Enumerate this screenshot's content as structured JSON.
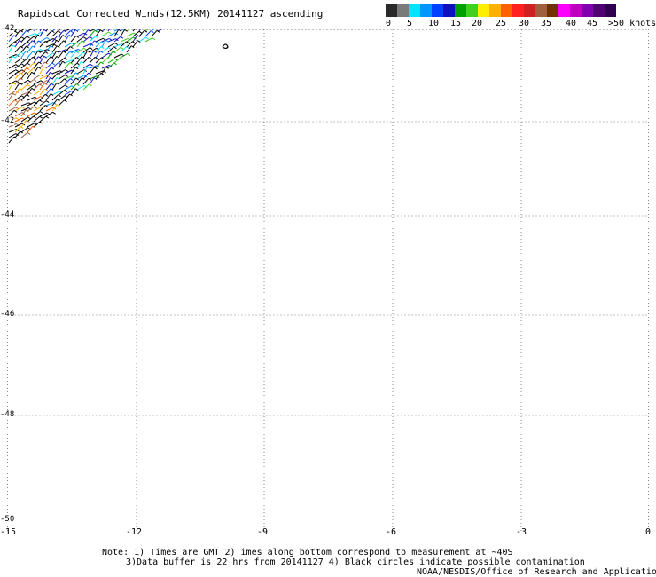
{
  "title": "Rapidscat Corrected Winds(12.5KM) 20141127 ascending",
  "legend": {
    "unit_label": ">50 knots",
    "labels": [
      "0",
      "5",
      "10",
      "15",
      "20",
      "25",
      "30",
      "35",
      "40",
      "45"
    ],
    "colors": [
      "#2a2a2a",
      "#7a7a7a",
      "#00e5ff",
      "#0096ff",
      "#0040ff",
      "#1010c0",
      "#00a000",
      "#40d020",
      "#ffee00",
      "#ffb000",
      "#ff6000",
      "#ff2020",
      "#d02020",
      "#a06040",
      "#703000",
      "#ff00ff",
      "#c000c0",
      "#8000b0",
      "#500070",
      "#300050"
    ]
  },
  "axes": {
    "x_ticks": [
      "-15",
      "-12",
      "-9",
      "-6",
      "-3",
      "0"
    ],
    "y_ticks": [
      "-42",
      "-42",
      "-44",
      "-46",
      "-48",
      "-50"
    ]
  },
  "notes": {
    "line1": "Note: 1) Times are GMT 2)Times along bottom correspond to measurement at ~40S",
    "line2": "3)Data buffer is 22 hrs from 20141127 4) Black circles indicate possible contamination",
    "line3": "NOAA/NESDIS/Office of Research and Applications"
  }
}
